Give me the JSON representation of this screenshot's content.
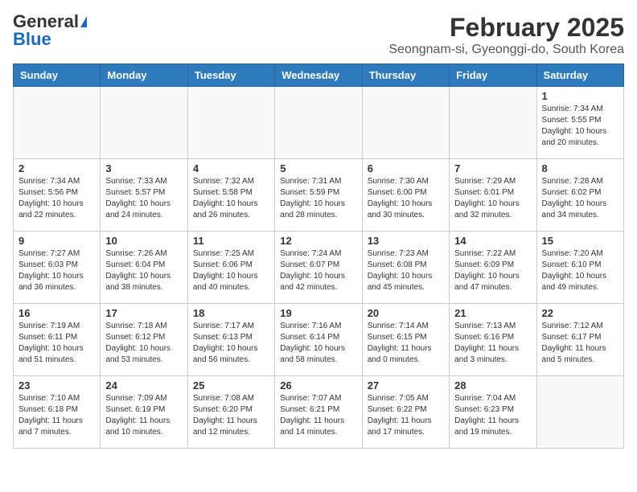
{
  "header": {
    "logo_general": "General",
    "logo_blue": "Blue",
    "main_title": "February 2025",
    "subtitle": "Seongnam-si, Gyeonggi-do, South Korea"
  },
  "days_of_week": [
    "Sunday",
    "Monday",
    "Tuesday",
    "Wednesday",
    "Thursday",
    "Friday",
    "Saturday"
  ],
  "weeks": [
    [
      {
        "day": "",
        "info": ""
      },
      {
        "day": "",
        "info": ""
      },
      {
        "day": "",
        "info": ""
      },
      {
        "day": "",
        "info": ""
      },
      {
        "day": "",
        "info": ""
      },
      {
        "day": "",
        "info": ""
      },
      {
        "day": "1",
        "info": "Sunrise: 7:34 AM\nSunset: 5:55 PM\nDaylight: 10 hours\nand 20 minutes."
      }
    ],
    [
      {
        "day": "2",
        "info": "Sunrise: 7:34 AM\nSunset: 5:56 PM\nDaylight: 10 hours\nand 22 minutes."
      },
      {
        "day": "3",
        "info": "Sunrise: 7:33 AM\nSunset: 5:57 PM\nDaylight: 10 hours\nand 24 minutes."
      },
      {
        "day": "4",
        "info": "Sunrise: 7:32 AM\nSunset: 5:58 PM\nDaylight: 10 hours\nand 26 minutes."
      },
      {
        "day": "5",
        "info": "Sunrise: 7:31 AM\nSunset: 5:59 PM\nDaylight: 10 hours\nand 28 minutes."
      },
      {
        "day": "6",
        "info": "Sunrise: 7:30 AM\nSunset: 6:00 PM\nDaylight: 10 hours\nand 30 minutes."
      },
      {
        "day": "7",
        "info": "Sunrise: 7:29 AM\nSunset: 6:01 PM\nDaylight: 10 hours\nand 32 minutes."
      },
      {
        "day": "8",
        "info": "Sunrise: 7:28 AM\nSunset: 6:02 PM\nDaylight: 10 hours\nand 34 minutes."
      }
    ],
    [
      {
        "day": "9",
        "info": "Sunrise: 7:27 AM\nSunset: 6:03 PM\nDaylight: 10 hours\nand 36 minutes."
      },
      {
        "day": "10",
        "info": "Sunrise: 7:26 AM\nSunset: 6:04 PM\nDaylight: 10 hours\nand 38 minutes."
      },
      {
        "day": "11",
        "info": "Sunrise: 7:25 AM\nSunset: 6:06 PM\nDaylight: 10 hours\nand 40 minutes."
      },
      {
        "day": "12",
        "info": "Sunrise: 7:24 AM\nSunset: 6:07 PM\nDaylight: 10 hours\nand 42 minutes."
      },
      {
        "day": "13",
        "info": "Sunrise: 7:23 AM\nSunset: 6:08 PM\nDaylight: 10 hours\nand 45 minutes."
      },
      {
        "day": "14",
        "info": "Sunrise: 7:22 AM\nSunset: 6:09 PM\nDaylight: 10 hours\nand 47 minutes."
      },
      {
        "day": "15",
        "info": "Sunrise: 7:20 AM\nSunset: 6:10 PM\nDaylight: 10 hours\nand 49 minutes."
      }
    ],
    [
      {
        "day": "16",
        "info": "Sunrise: 7:19 AM\nSunset: 6:11 PM\nDaylight: 10 hours\nand 51 minutes."
      },
      {
        "day": "17",
        "info": "Sunrise: 7:18 AM\nSunset: 6:12 PM\nDaylight: 10 hours\nand 53 minutes."
      },
      {
        "day": "18",
        "info": "Sunrise: 7:17 AM\nSunset: 6:13 PM\nDaylight: 10 hours\nand 56 minutes."
      },
      {
        "day": "19",
        "info": "Sunrise: 7:16 AM\nSunset: 6:14 PM\nDaylight: 10 hours\nand 58 minutes."
      },
      {
        "day": "20",
        "info": "Sunrise: 7:14 AM\nSunset: 6:15 PM\nDaylight: 11 hours\nand 0 minutes."
      },
      {
        "day": "21",
        "info": "Sunrise: 7:13 AM\nSunset: 6:16 PM\nDaylight: 11 hours\nand 3 minutes."
      },
      {
        "day": "22",
        "info": "Sunrise: 7:12 AM\nSunset: 6:17 PM\nDaylight: 11 hours\nand 5 minutes."
      }
    ],
    [
      {
        "day": "23",
        "info": "Sunrise: 7:10 AM\nSunset: 6:18 PM\nDaylight: 11 hours\nand 7 minutes."
      },
      {
        "day": "24",
        "info": "Sunrise: 7:09 AM\nSunset: 6:19 PM\nDaylight: 11 hours\nand 10 minutes."
      },
      {
        "day": "25",
        "info": "Sunrise: 7:08 AM\nSunset: 6:20 PM\nDaylight: 11 hours\nand 12 minutes."
      },
      {
        "day": "26",
        "info": "Sunrise: 7:07 AM\nSunset: 6:21 PM\nDaylight: 11 hours\nand 14 minutes."
      },
      {
        "day": "27",
        "info": "Sunrise: 7:05 AM\nSunset: 6:22 PM\nDaylight: 11 hours\nand 17 minutes."
      },
      {
        "day": "28",
        "info": "Sunrise: 7:04 AM\nSunset: 6:23 PM\nDaylight: 11 hours\nand 19 minutes."
      },
      {
        "day": "",
        "info": ""
      }
    ]
  ]
}
